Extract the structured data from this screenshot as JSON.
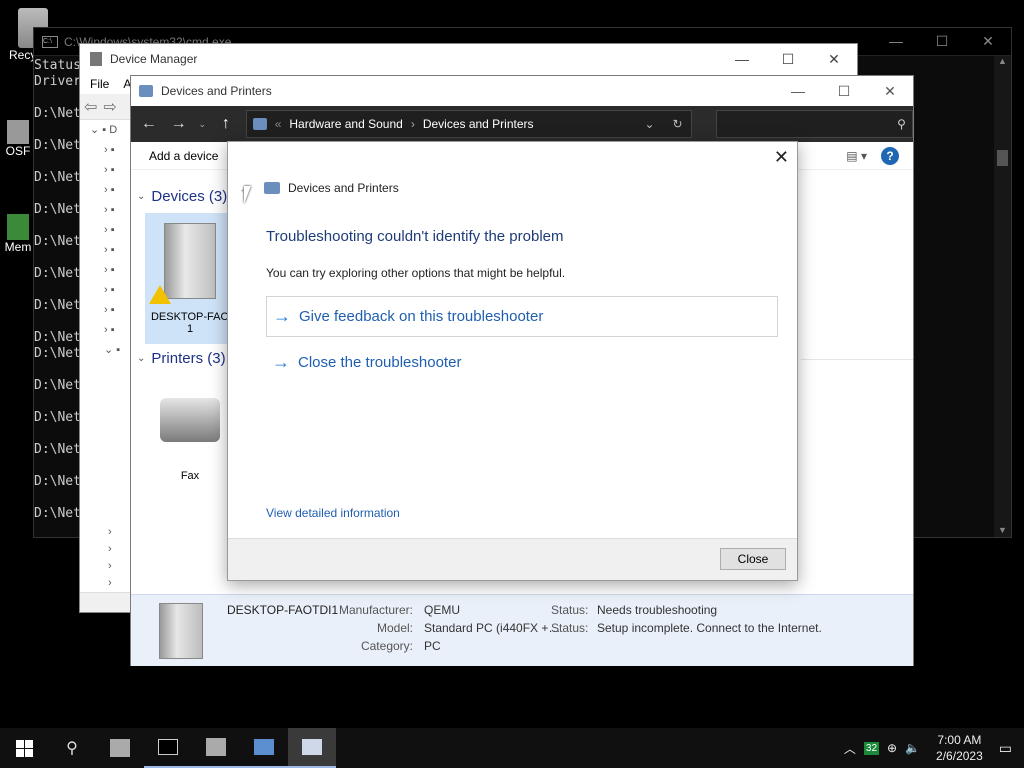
{
  "desktop": {
    "icons": [
      {
        "label": "Recy"
      },
      {
        "label": "OSF"
      },
      {
        "label": "Mem"
      }
    ]
  },
  "cmd": {
    "title": "C:\\Windows\\system32\\cmd.exe",
    "lines": [
      "Status",
      "Driver",
      "",
      "D:\\Net",
      "",
      "D:\\Net",
      "",
      "D:\\Net",
      "",
      "D:\\Net",
      "",
      "D:\\Net",
      "",
      "D:\\Net",
      "",
      "D:\\Net",
      "",
      "D:\\Net",
      "D:\\Net",
      "",
      "D:\\Net",
      "",
      "D:\\Net",
      "",
      "D:\\Net",
      "",
      "D:\\Net",
      "",
      "D:\\Net"
    ]
  },
  "device_manager": {
    "title": "Device Manager",
    "menu": [
      "File",
      "A"
    ]
  },
  "devices_printers": {
    "title": "Devices and Printers",
    "breadcrumb": [
      "Hardware and Sound",
      "Devices and Printers"
    ],
    "add_device": "Add a device",
    "devices_group": "Devices (3)",
    "printers_group": "Printers (3)",
    "device_name": "DESKTOP-FAO",
    "device_name2": "1",
    "fax_label": "Fax",
    "details": {
      "name": "DESKTOP-FAOTDI1",
      "manufacturer_label": "Manufacturer:",
      "manufacturer": "QEMU",
      "model_label": "Model:",
      "model": "Standard PC (i440FX +…",
      "category_label": "Category:",
      "category": "PC",
      "status_label": "Status:",
      "status1": "Needs troubleshooting",
      "status2": "Setup incomplete. Connect to the Internet."
    }
  },
  "dialog": {
    "header": "Devices and Printers",
    "title": "Troubleshooting couldn't identify the problem",
    "subtitle": "You can try exploring other options that might be helpful.",
    "option1": "Give feedback on this troubleshooter",
    "option2": "Close the troubleshooter",
    "view_details": "View detailed information",
    "close_button": "Close"
  },
  "taskbar": {
    "time": "7:00 AM",
    "date": "2/6/2023",
    "badge": "32"
  }
}
